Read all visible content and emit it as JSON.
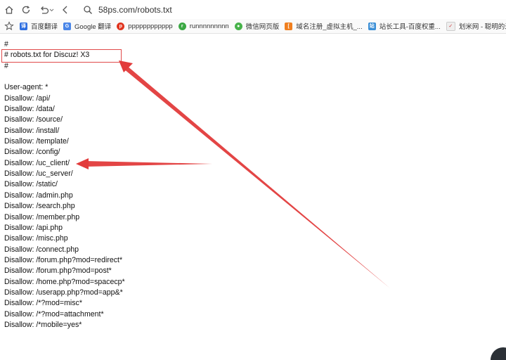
{
  "toolbar": {
    "url": "58ps.com/robots.txt"
  },
  "icons": {
    "home": "home-icon",
    "refresh": "refresh-icon",
    "undo": "undo-icon",
    "back": "back-icon",
    "search": "search-icon",
    "star": "star-icon"
  },
  "bookmarks": [
    {
      "label": "百度翻译",
      "icon": "baidu-translate-icon",
      "color": "#2f6fe0"
    },
    {
      "label": "Google 翻译",
      "icon": "google-translate-icon",
      "color": "#4a86e8"
    },
    {
      "label": "pppppppppppp",
      "icon": "p-icon",
      "color": "#e0341e"
    },
    {
      "label": "runnnnnnnnn",
      "icon": "r-icon",
      "color": "#3aa843"
    },
    {
      "label": "微信网页版",
      "icon": "wechat-icon",
      "color": "#47b24a"
    },
    {
      "label": "域名注册_虚拟主机_...",
      "icon": "domain-icon",
      "color": "#f07f1e"
    },
    {
      "label": "站长工具-百度权重...",
      "icon": "webmaster-icon",
      "color": "#3b8fd6"
    },
    {
      "label": "划米网 - 聪明的米农...",
      "icon": "huami-icon",
      "color": "#e9e9e9"
    }
  ],
  "robots": {
    "lines": [
      "#",
      "# robots.txt for Discuz! X3",
      "#",
      "",
      "User-agent: *",
      "Disallow: /api/",
      "Disallow: /data/",
      "Disallow: /source/",
      "Disallow: /install/",
      "Disallow: /template/",
      "Disallow: /config/",
      "Disallow: /uc_client/",
      "Disallow: /uc_server/",
      "Disallow: /static/",
      "Disallow: /admin.php",
      "Disallow: /search.php",
      "Disallow: /member.php",
      "Disallow: /api.php",
      "Disallow: /misc.php",
      "Disallow: /connect.php",
      "Disallow: /forum.php?mod=redirect*",
      "Disallow: /forum.php?mod=post*",
      "Disallow: /home.php?mod=spacecp*",
      "Disallow: /userapp.php?mod=app&*",
      "Disallow: /*?mod=misc*",
      "Disallow: /*?mod=attachment*",
      "Disallow: /*mobile=yes*"
    ]
  },
  "annotation_color": "#e23b3b"
}
